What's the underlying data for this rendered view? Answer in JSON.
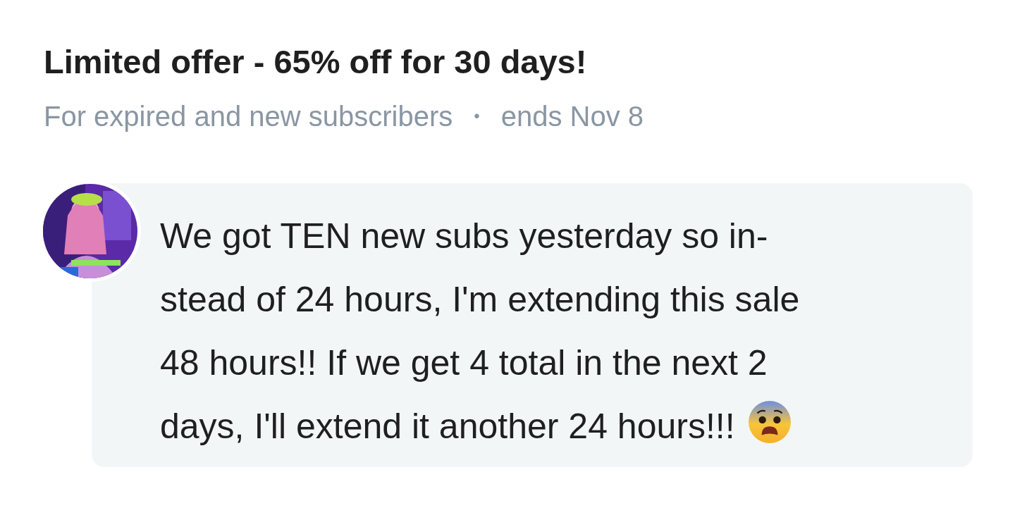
{
  "offer": {
    "title": "Limited offer - 65% off for 30 days!",
    "audience": "For expired and new subscribers",
    "separator": "•",
    "ends": "ends Nov 8"
  },
  "message": {
    "lines": [
      "We got TEN new subs yesterday so in-",
      "stead of 24 hours, I'm extending this sale",
      "48 hours!! If we get 4 total in the next 2",
      "days, I'll extend it another 24 hours!!!"
    ]
  }
}
